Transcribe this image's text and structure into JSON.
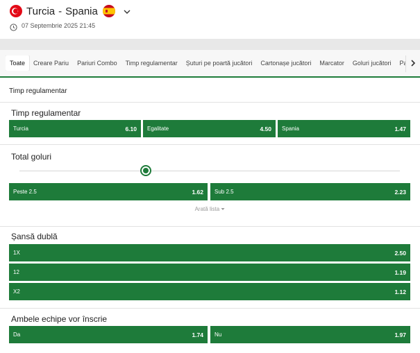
{
  "match": {
    "home": "Turcia",
    "separator": "-",
    "away": "Spania",
    "datetime": "07 Septembrie 2025 21:45",
    "home_flag_icon": "turkey-flag-icon",
    "away_flag_icon": "spain-flag-icon"
  },
  "tabs": [
    {
      "label": "Toate",
      "active": true
    },
    {
      "label": "Creare Pariu"
    },
    {
      "label": "Pariuri Combo"
    },
    {
      "label": "Timp regulamentar"
    },
    {
      "label": "Șuturi pe poartă jucători"
    },
    {
      "label": "Cartonașe jucători"
    },
    {
      "label": "Marcator"
    },
    {
      "label": "Goluri jucători"
    },
    {
      "label": "Pas"
    }
  ],
  "section": {
    "title": "Timp regulamentar"
  },
  "markets": {
    "result": {
      "title": "Timp regulamentar",
      "odds": [
        {
          "label": "Turcia",
          "value": "6.10"
        },
        {
          "label": "Egalitate",
          "value": "4.50"
        },
        {
          "label": "Spania",
          "value": "1.47"
        }
      ]
    },
    "total_goals": {
      "title": "Total goluri",
      "odds": [
        {
          "label": "Peste  2.5",
          "value": "1.62"
        },
        {
          "label": "Sub  2.5",
          "value": "2.23"
        }
      ],
      "show_list": "Arată lista"
    },
    "double_chance": {
      "title": "Șansă dublă",
      "odds": [
        {
          "label": "1X",
          "value": "2.50"
        },
        {
          "label": "12",
          "value": "1.19"
        },
        {
          "label": "X2",
          "value": "1.12"
        }
      ]
    },
    "btts": {
      "title": "Ambele echipe vor înscrie",
      "odds": [
        {
          "label": "Da",
          "value": "1.74"
        },
        {
          "label": "Nu",
          "value": "1.97"
        }
      ]
    }
  },
  "colors": {
    "accent": "#1e7b3a",
    "band": "#e8e8e8"
  }
}
